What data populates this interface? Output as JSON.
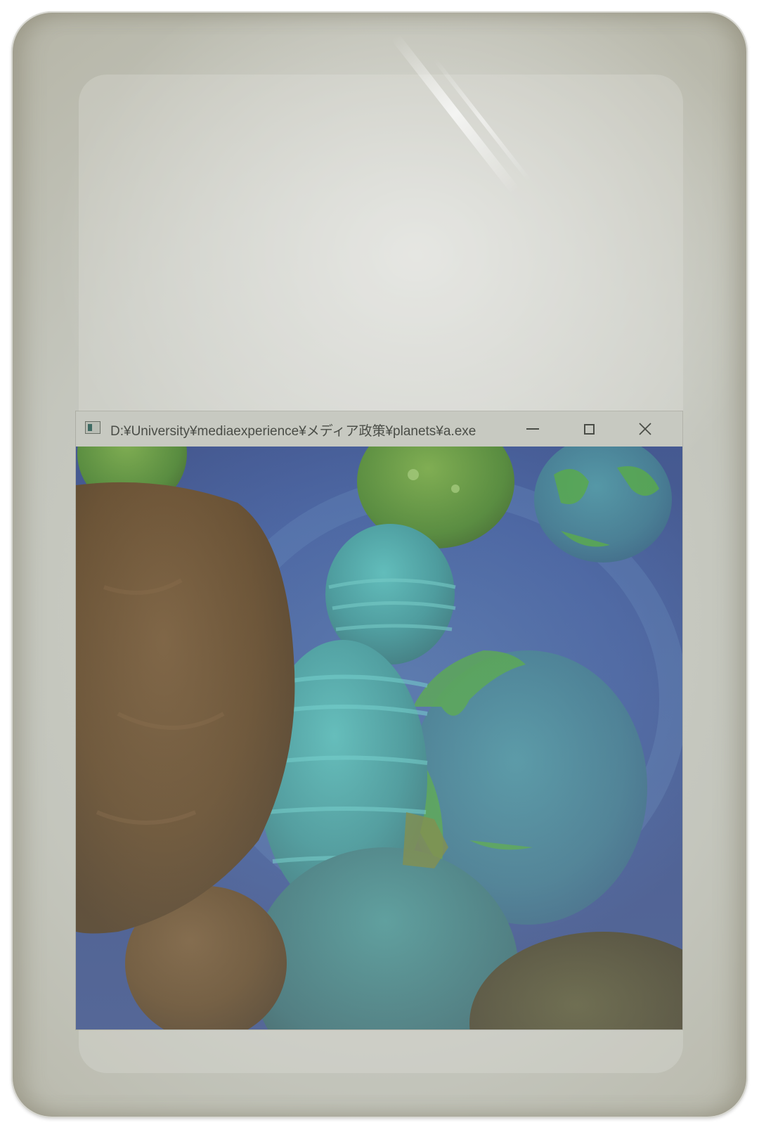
{
  "window": {
    "title": "D:¥University¥mediaexperience¥メディア政策¥planets¥a.exe",
    "controls": {
      "minimize": "minimize-icon",
      "maximize": "maximize-icon",
      "close": "close-icon"
    }
  },
  "scene": {
    "background": "#2f4f9c",
    "planet_colors": {
      "rocky_brown": "#5a3d1f",
      "gas_teal": "#2e8e92",
      "earth_blue": "#2f6f8c",
      "earth_green": "#3ea033",
      "moss_green": "#3f7d23"
    }
  }
}
